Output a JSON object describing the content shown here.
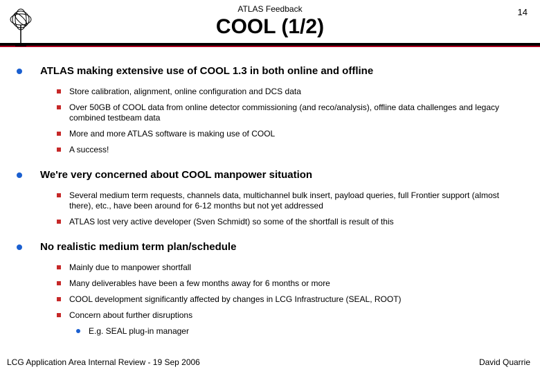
{
  "header": "ATLAS Feedback",
  "pageNum": "14",
  "title": "COOL (1/2)",
  "sections": [
    {
      "heading": "ATLAS making extensive use of COOL 1.3 in both online and offline",
      "items": [
        {
          "text": "Store calibration, alignment, online configuration and DCS data"
        },
        {
          "text": "Over 50GB of COOL data from online detector commissioning (and reco/analysis), offline data challenges and legacy combined testbeam data"
        },
        {
          "text": "More and more ATLAS software is making use of COOL"
        },
        {
          "text": "A success!"
        }
      ]
    },
    {
      "heading": "We're very concerned about COOL manpower situation",
      "items": [
        {
          "text": "Several medium term requests, channels data, multichannel bulk insert, payload queries, full Frontier support (almost there), etc., have been around for 6-12 months but not yet addressed"
        },
        {
          "text": "ATLAS lost very active developer (Sven Schmidt) so some of the shortfall is result of this"
        }
      ]
    },
    {
      "heading": "No realistic medium term plan/schedule",
      "items": [
        {
          "text": "Mainly due to manpower shortfall"
        },
        {
          "text": "Many deliverables have been a few months away for 6 months or more"
        },
        {
          "text": "COOL development significantly affected by changes in LCG Infrastructure (SEAL, ROOT)"
        },
        {
          "text": "Concern about further disruptions",
          "sub": [
            {
              "text": "E.g. SEAL plug-in manager"
            }
          ]
        }
      ]
    }
  ],
  "footerLeft": "LCG Application Area Internal Review - 19 Sep 2006",
  "footerRight": "David Quarrie"
}
